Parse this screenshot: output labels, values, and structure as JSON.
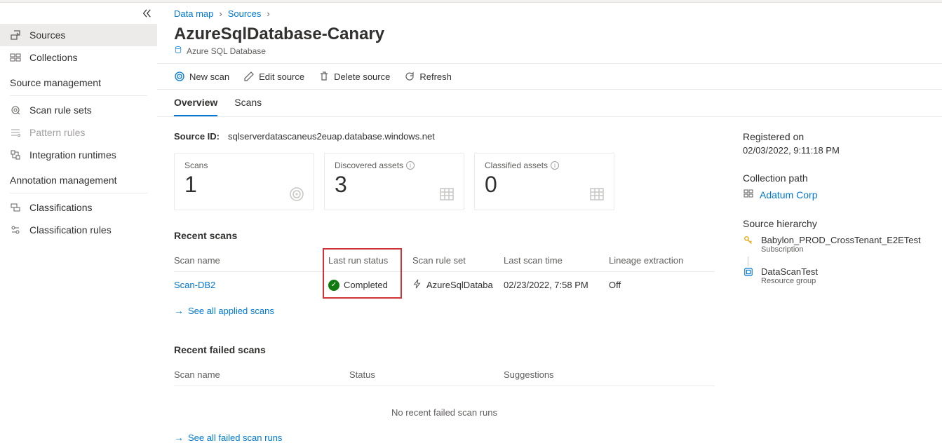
{
  "breadcrumb": {
    "item1": "Data map",
    "item2": "Sources"
  },
  "page": {
    "title": "AzureSqlDatabase-Canary",
    "subtitle": "Azure SQL Database"
  },
  "sidebar": {
    "items": {
      "sources": "Sources",
      "collections": "Collections"
    },
    "headings": {
      "source_mgmt": "Source management",
      "annotation_mgmt": "Annotation management"
    },
    "source_mgmt_items": {
      "scan_rule_sets": "Scan rule sets",
      "pattern_rules": "Pattern rules",
      "integration_runtimes": "Integration runtimes"
    },
    "annotation_items": {
      "classifications": "Classifications",
      "classification_rules": "Classification rules"
    }
  },
  "toolbar": {
    "new_scan": "New scan",
    "edit_source": "Edit source",
    "delete_source": "Delete source",
    "refresh": "Refresh"
  },
  "tabs": {
    "overview": "Overview",
    "scans": "Scans"
  },
  "source_id": {
    "label": "Source ID:",
    "value": "sqlserverdatascaneus2euap.database.windows.net"
  },
  "cards": {
    "scans": {
      "label": "Scans",
      "value": "1"
    },
    "discovered": {
      "label": "Discovered assets",
      "value": "3"
    },
    "classified": {
      "label": "Classified assets",
      "value": "0"
    }
  },
  "recent_scans": {
    "title": "Recent scans",
    "headers": {
      "scan_name": "Scan name",
      "last_run_status": "Last run status",
      "scan_rule_set": "Scan rule set",
      "last_scan_time": "Last scan time",
      "lineage_extraction": "Lineage extraction"
    },
    "row": {
      "scan_name": "Scan-DB2",
      "status": "Completed",
      "rule_set": "AzureSqlDataba",
      "last_time": "02/23/2022, 7:58 PM",
      "lineage": "Off"
    },
    "see_all": "See all applied scans"
  },
  "failed_scans": {
    "title": "Recent failed scans",
    "headers": {
      "scan_name": "Scan name",
      "status": "Status",
      "suggestions": "Suggestions"
    },
    "empty": "No recent failed scan runs",
    "see_all": "See all failed scan runs"
  },
  "side": {
    "registered": {
      "label": "Registered on",
      "value": "02/03/2022, 9:11:18 PM"
    },
    "collection_path": {
      "label": "Collection path",
      "value": "Adatum Corp"
    },
    "hierarchy": {
      "label": "Source hierarchy",
      "item1": {
        "name": "Babylon_PROD_CrossTenant_E2ETest",
        "type": "Subscription"
      },
      "item2": {
        "name": "DataScanTest",
        "type": "Resource group"
      }
    }
  }
}
